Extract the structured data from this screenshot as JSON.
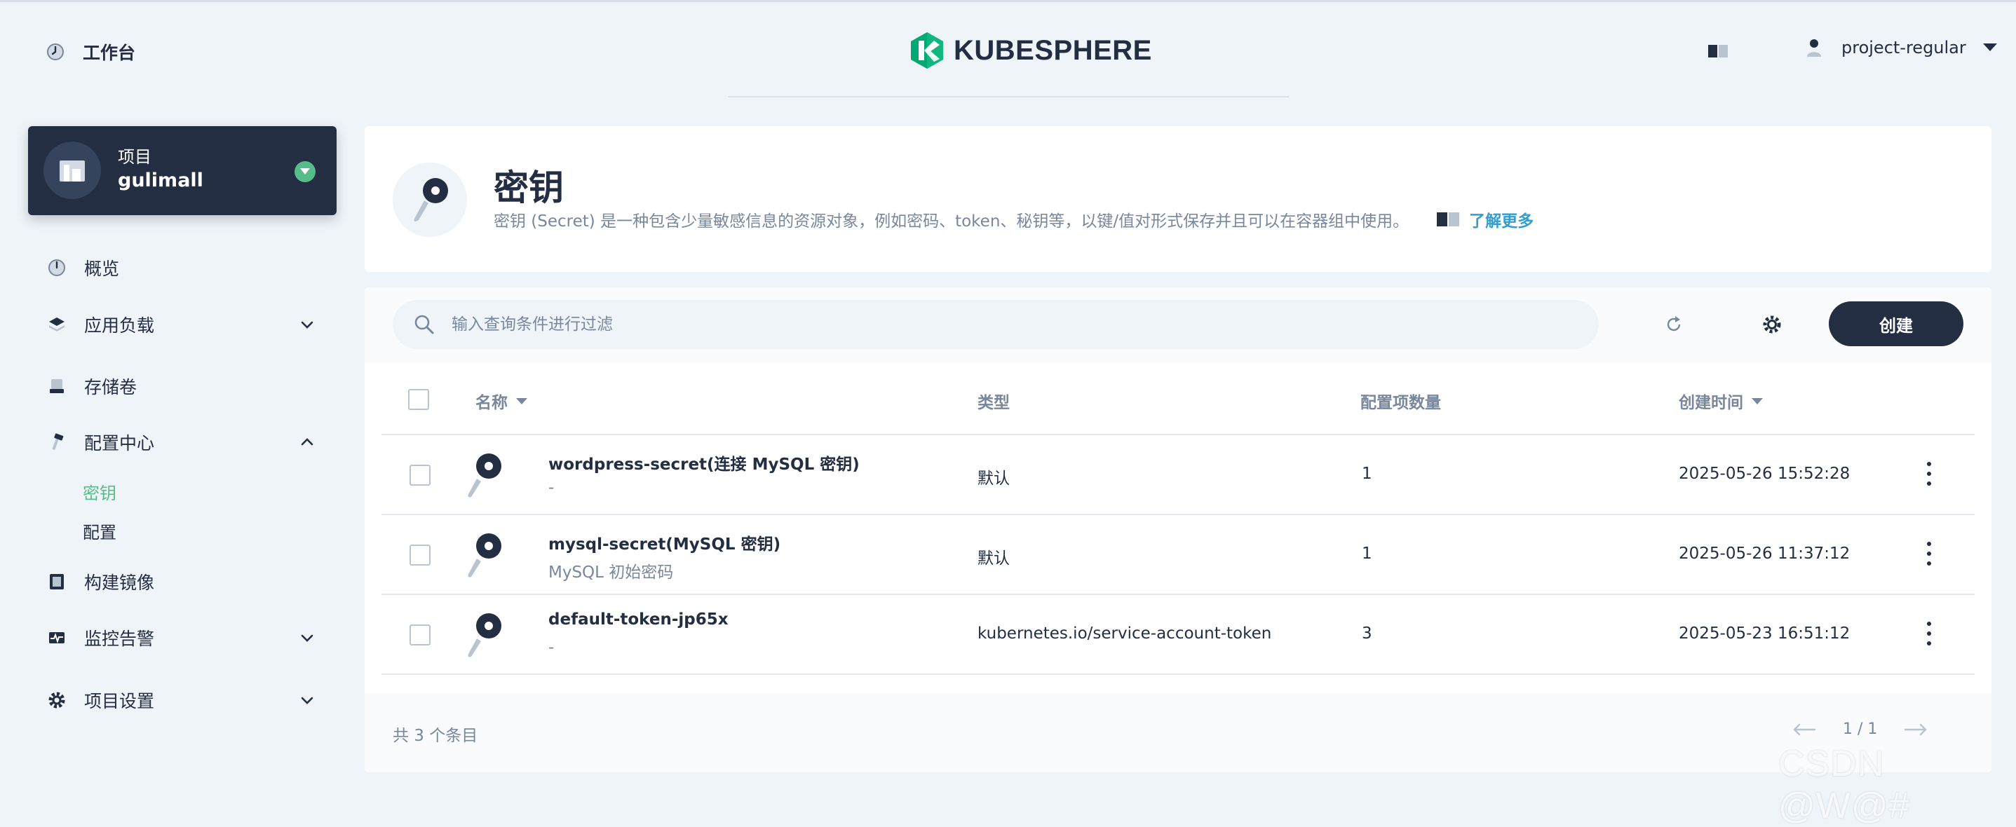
{
  "topbar": {
    "workspace_label": "工作台",
    "logo_text": "KUBESPHERE",
    "username": "project-regular"
  },
  "project": {
    "label": "项目",
    "name": "gulimall"
  },
  "sidebar": {
    "items": [
      {
        "label": "概览",
        "icon": "dashboard-icon"
      },
      {
        "label": "应用负载",
        "icon": "layers-icon",
        "expandable": true
      },
      {
        "label": "存储卷",
        "icon": "storage-icon"
      },
      {
        "label": "配置中心",
        "icon": "hammer-icon",
        "expanded": true
      },
      {
        "label": "构建镜像",
        "icon": "image-builder-icon"
      },
      {
        "label": "监控告警",
        "icon": "monitor-icon",
        "expandable": true
      },
      {
        "label": "项目设置",
        "icon": "gear-icon",
        "expandable": true
      }
    ],
    "config_sub": [
      {
        "label": "密钥",
        "active": true
      },
      {
        "label": "配置",
        "active": false
      }
    ]
  },
  "header": {
    "title": "密钥",
    "description": "密钥 (Secret) 是一种包含少量敏感信息的资源对象，例如密码、token、秘钥等，以键/值对形式保存并且可以在容器组中使用。",
    "learn_more": "了解更多"
  },
  "toolbar": {
    "search_placeholder": "输入查询条件进行过滤",
    "create_label": "创建"
  },
  "table": {
    "columns": [
      "名称",
      "类型",
      "配置项数量",
      "创建时间"
    ],
    "rows": [
      {
        "name": "wordpress-secret(连接 MySQL 密钥)",
        "desc": "-",
        "type": "默认",
        "count": "1",
        "created": "2025-05-26 15:52:28"
      },
      {
        "name": "mysql-secret(MySQL 密钥)",
        "desc": "MySQL 初始密码",
        "type": "默认",
        "count": "1",
        "created": "2025-05-26 11:37:12"
      },
      {
        "name": "default-token-jp65x",
        "desc": "-",
        "type": "kubernetes.io/service-account-token",
        "count": "3",
        "created": "2025-05-23 16:51:12"
      }
    ]
  },
  "footer": {
    "total": "共 3 个条目",
    "page": "1 / 1"
  },
  "watermark": "CSDN @W@#",
  "colors": {
    "accent": "#55bc8a",
    "dark": "#242e42",
    "link": "#329dce",
    "muted": "#79879c",
    "background": "#eff4f9"
  }
}
